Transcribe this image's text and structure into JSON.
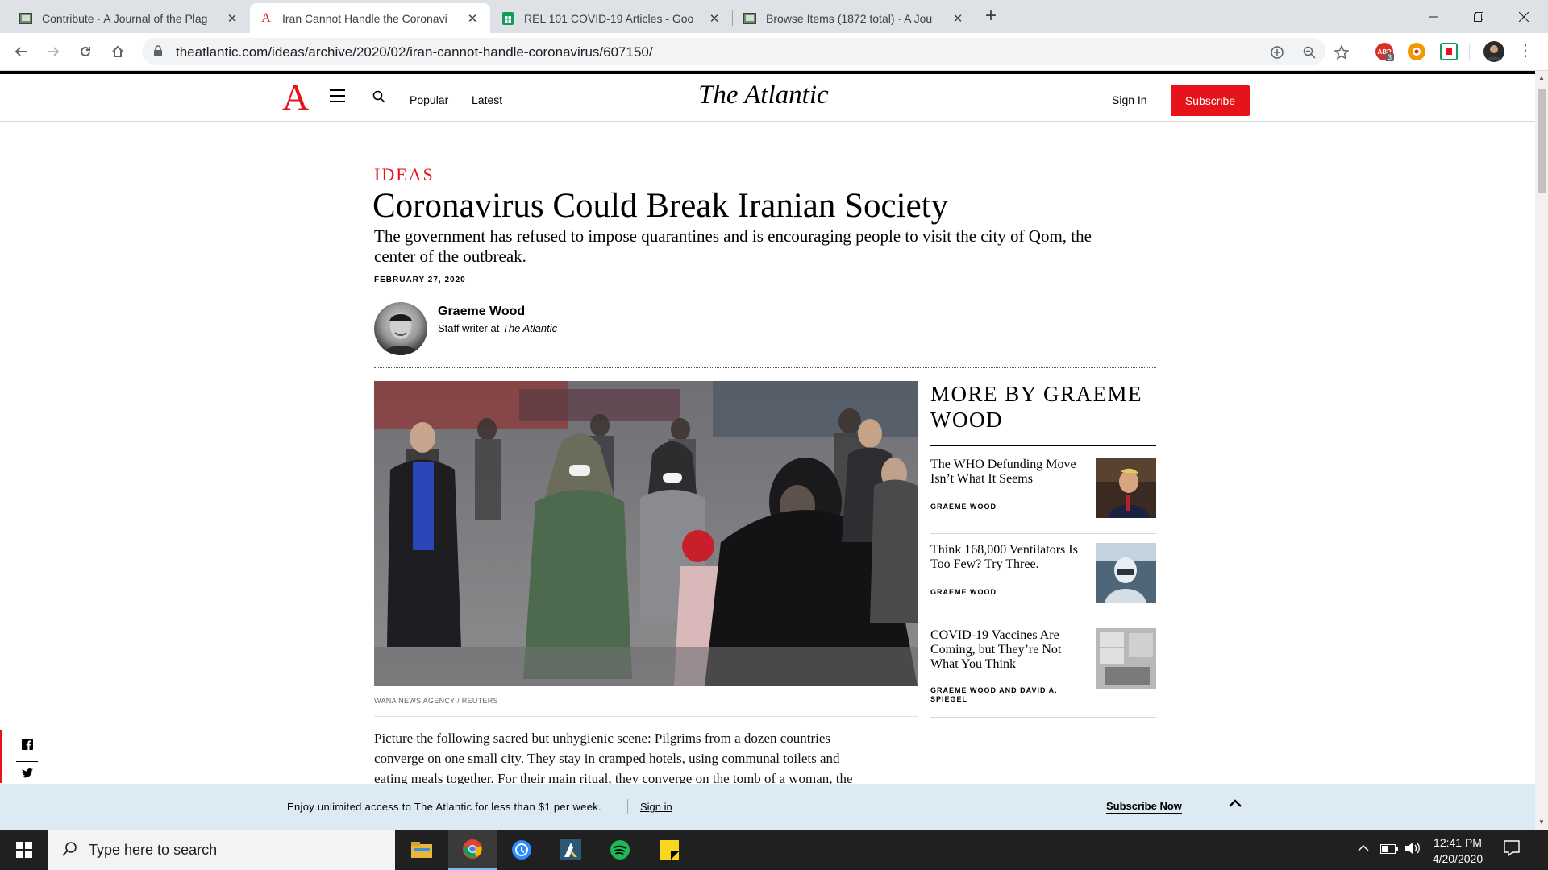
{
  "browser": {
    "tabs": [
      {
        "title": "Contribute · A Journal of the Plag",
        "active": false
      },
      {
        "title": "Iran Cannot Handle the Coronavi",
        "active": true
      },
      {
        "title": "REL 101 COVID-19 Articles - Goo",
        "active": false
      },
      {
        "title": "Browse Items (1872 total) · A Jou",
        "active": false
      }
    ],
    "url": "theatlantic.com/ideas/archive/2020/02/iran-cannot-handle-coronavirus/607150/",
    "extension_badge": "3"
  },
  "site": {
    "logo_letter": "A",
    "masthead": "The Atlantic",
    "nav": {
      "popular": "Popular",
      "latest": "Latest"
    },
    "sign_in": "Sign In",
    "subscribe": "Subscribe",
    "accent": "#e7131a"
  },
  "article": {
    "section": "IDEAS",
    "headline": "Coronavirus Could Break Iranian Society",
    "dek": "The government has refused to impose quarantines and is encouraging people to visit the city of Qom, the center of the outbreak.",
    "date": "FEBRUARY 27, 2020",
    "author": {
      "name": "Graeme Wood",
      "role_prefix": "Staff writer at ",
      "role_pub": "The Atlantic"
    },
    "image_credit": "WANA NEWS AGENCY / REUTERS",
    "body_lines": [
      "Picture the following sacred but unhygienic scene: Pilgrims from a dozen countries",
      "converge on one small city. They stay in cramped hotels, using communal toilets and",
      "eating meals together. For their main ritual, they converge on the tomb of a woman, the"
    ]
  },
  "sidebar": {
    "title": "MORE BY GRAEME WOOD",
    "items": [
      {
        "title": "The WHO Defunding Move Isn’t What It Seems",
        "author": "GRAEME WOOD"
      },
      {
        "title": "Think 168,000 Ventilators Is Too Few? Try Three.",
        "author": "GRAEME WOOD"
      },
      {
        "title": "COVID-19 Vaccines Are Coming, but They’re Not What You Think",
        "author": "GRAEME WOOD AND DAVID A. SPIEGEL"
      }
    ]
  },
  "banner": {
    "message": "Enjoy unlimited access to The Atlantic for less than $1 per week.",
    "sign_in": "Sign in",
    "subscribe_now": "Subscribe Now"
  },
  "taskbar": {
    "search_placeholder": "Type here to search",
    "time": "12:41 PM",
    "date": "4/20/2020"
  }
}
